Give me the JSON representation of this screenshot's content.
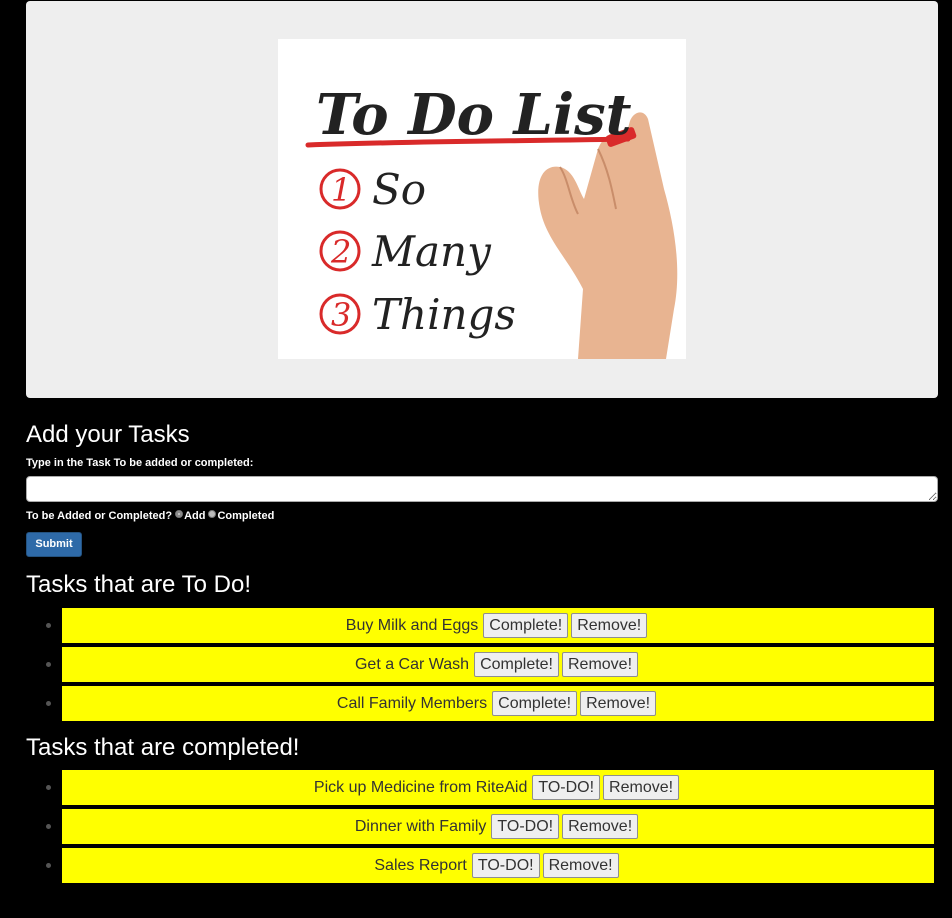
{
  "hero": {
    "title": "To Do List",
    "items": [
      {
        "num": "1",
        "text": "So"
      },
      {
        "num": "2",
        "text": "Many"
      },
      {
        "num": "3",
        "text": "Things"
      }
    ],
    "accent_color": "#d92a2a"
  },
  "form": {
    "heading": "Add your Tasks",
    "input_label": "Type in the Task To be added or completed:",
    "input_value": "",
    "radio_question": "To be Added or Completed?",
    "radio_options": [
      "Add",
      "Completed"
    ],
    "submit_label": "Submit"
  },
  "todo": {
    "heading": "Tasks that are To Do!",
    "action_label": "Complete!",
    "remove_label": "Remove!",
    "items": [
      "Buy Milk and Eggs",
      "Get a Car Wash",
      "Call Family Members"
    ]
  },
  "completed": {
    "heading": "Tasks that are completed!",
    "action_label": "TO-DO!",
    "remove_label": "Remove!",
    "items": [
      "Pick up Medicine from RiteAid",
      "Dinner with Family",
      "Sales Report"
    ]
  },
  "colors": {
    "page_bg": "#000000",
    "task_bg": "#ffff00",
    "submit_bg": "#2e6aa8",
    "hero_bg": "#eeeeee"
  }
}
